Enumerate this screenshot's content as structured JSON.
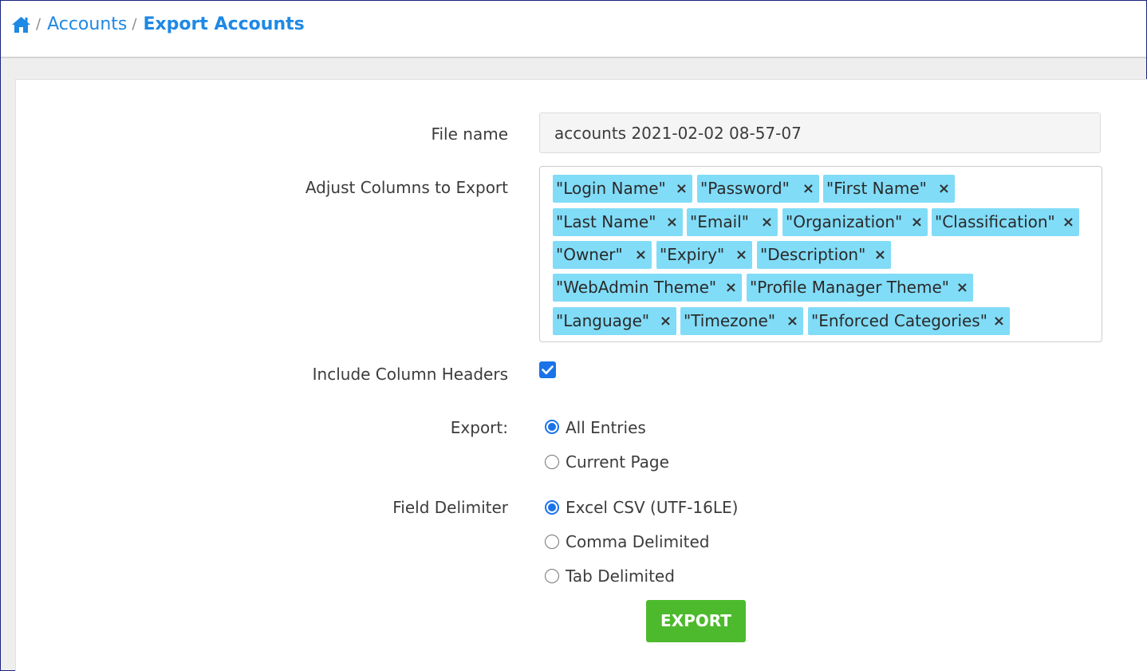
{
  "breadcrumb": {
    "home_icon": "home-icon",
    "separator": "/",
    "parent": "Accounts",
    "current": "Export Accounts"
  },
  "form": {
    "file_name_label": "File name",
    "file_name_value": "accounts 2021-02-02 08-57-07",
    "columns_label": "Adjust Columns to Export",
    "columns": [
      "\"Login Name\"",
      "\"Password\"",
      "\"First Name\"",
      "\"Last Name\"",
      "\"Email\"",
      "\"Organization\"",
      "\"Classification\"",
      "\"Owner\"",
      "\"Expiry\"",
      "\"Description\"",
      "\"WebAdmin Theme\"",
      "\"Profile Manager Theme\"",
      "\"Language\"",
      "\"Timezone\"",
      "\"Enforced Categories\""
    ],
    "tag_remove_glyph": "×",
    "headers_label": "Include Column Headers",
    "headers_checked": true,
    "export_label": "Export:",
    "export_options": [
      "All Entries",
      "Current Page"
    ],
    "export_selected": "All Entries",
    "delimiter_label": "Field Delimiter",
    "delimiter_options": [
      "Excel CSV (UTF-16LE)",
      "Comma Delimited",
      "Tab Delimited"
    ],
    "delimiter_selected": "Excel CSV (UTF-16LE)",
    "export_button": "EXPORT"
  },
  "colors": {
    "accent": "#1e88e5",
    "tag_bg": "#81dcf7",
    "button_bg": "#4cba2c",
    "frame_border": "#1a237e"
  }
}
